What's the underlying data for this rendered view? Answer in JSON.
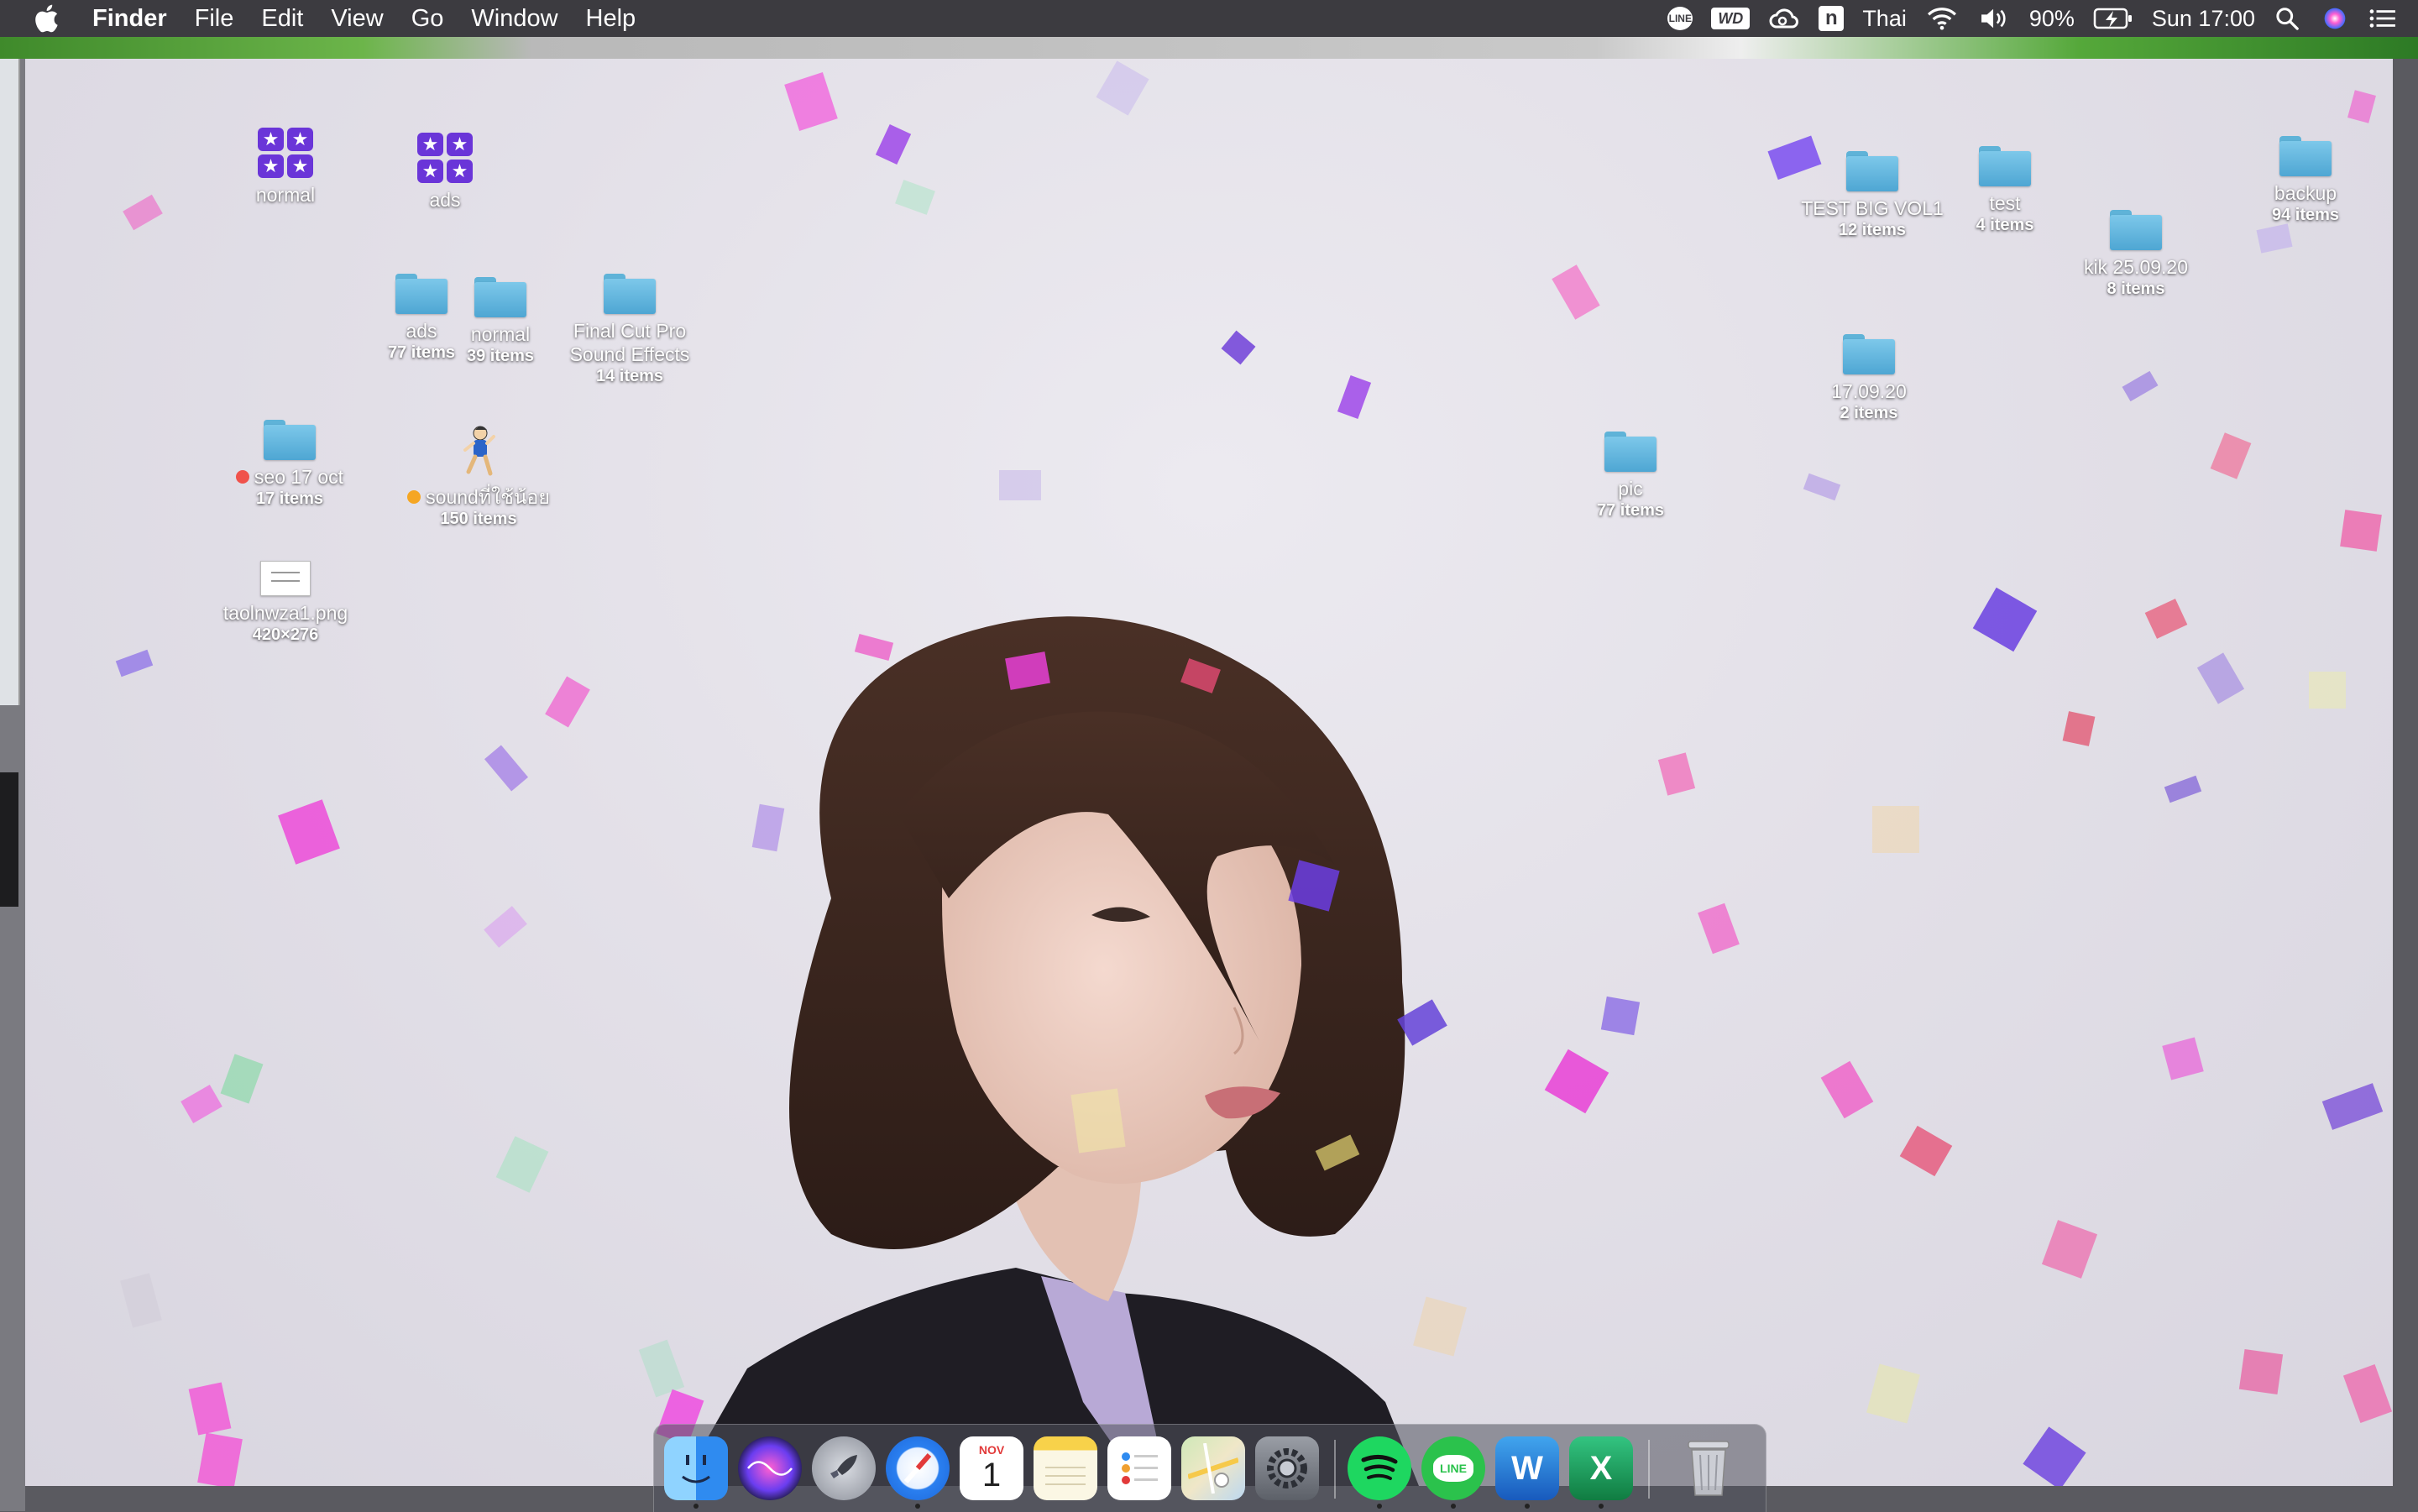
{
  "menubar": {
    "app_name": "Finder",
    "menus": [
      "File",
      "Edit",
      "View",
      "Go",
      "Window",
      "Help"
    ],
    "status": {
      "line_badge": "LINE",
      "wd_badge": "WD",
      "n_badge": "n",
      "input_source": "Thai",
      "battery_percent": "90%",
      "clock": "Sun 17:00"
    }
  },
  "desktop": {
    "icons": [
      {
        "name": "normal",
        "kind": "app",
        "sub": ""
      },
      {
        "name": "ads",
        "kind": "app",
        "sub": ""
      },
      {
        "name": "ads",
        "kind": "folder",
        "sub": "77 items"
      },
      {
        "name": "normal",
        "kind": "folder",
        "sub": "39 items"
      },
      {
        "name": "Final Cut Pro",
        "name2": "Sound Effects",
        "kind": "folder",
        "sub": "14 items"
      },
      {
        "name": "seo 17 oct",
        "kind": "folder",
        "sub": "17 items",
        "tag_color": "#f0524b"
      },
      {
        "name": "soundที่ใช้น้อย",
        "kind": "file",
        "sub": "150 items",
        "tag_color": "#f5a623"
      },
      {
        "name": "taolnwza1.png",
        "kind": "image",
        "sub": "420×276"
      },
      {
        "name": "TEST BIG VOL1",
        "kind": "folder",
        "sub": "12 items"
      },
      {
        "name": "test",
        "kind": "folder",
        "sub": "4 items"
      },
      {
        "name": "kik 25.09.20",
        "kind": "folder",
        "sub": "8 items"
      },
      {
        "name": "backup",
        "kind": "folder",
        "sub": "94 items"
      },
      {
        "name": "17.09.20",
        "kind": "folder",
        "sub": "2 items"
      },
      {
        "name": "pic",
        "kind": "folder",
        "sub": "77 items"
      }
    ]
  },
  "dock": {
    "calendar_month": "NOV",
    "calendar_day": "1",
    "line_label": "LINE",
    "word_letter": "W",
    "excel_letter": "X"
  }
}
